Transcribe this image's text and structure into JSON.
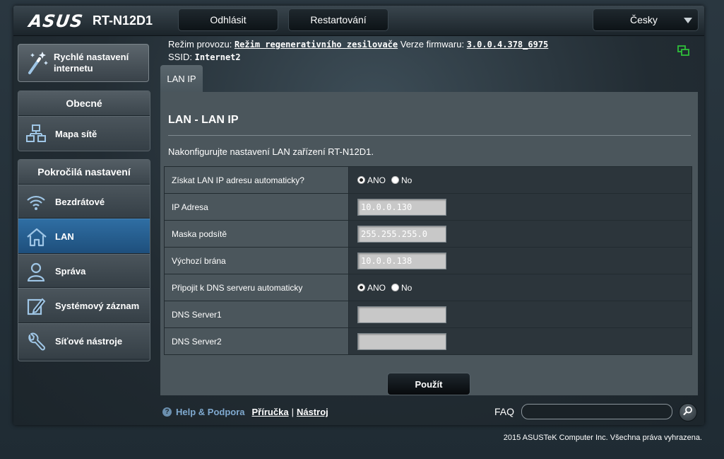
{
  "header": {
    "brand": "ASUS",
    "model": "RT-N12D1",
    "logout_label": "Odhlásit",
    "restart_label": "Restartování",
    "language": "Česky"
  },
  "info": {
    "mode_label": "Režim provozu:",
    "mode_value": "Režim regenerativního zesilovače",
    "firmware_label": "Verze firmwaru:",
    "firmware_value": "3.0.0.4.378_6975",
    "ssid_label": "SSID:",
    "ssid_value": "Internet2"
  },
  "sidebar": {
    "quick_setup": "Rychlé nastavení internetu",
    "general_header": "Obecné",
    "general_items": [
      {
        "label": "Mapa sítě",
        "icon": "network-map-icon"
      }
    ],
    "advanced_header": "Pokročilá nastavení",
    "advanced_items": [
      {
        "label": "Bezdrátové",
        "icon": "wifi-icon"
      },
      {
        "label": "LAN",
        "icon": "home-icon"
      },
      {
        "label": "Správa",
        "icon": "user-icon"
      },
      {
        "label": "Systémový záznam",
        "icon": "edit-log-icon"
      },
      {
        "label": "Síťové nástroje",
        "icon": "wrench-icon"
      }
    ],
    "active_item": "LAN"
  },
  "tab": {
    "label": "LAN IP"
  },
  "panel": {
    "title": "LAN - LAN IP",
    "description": "Nakonfigurujte nastavení LAN zařízení RT-N12D1.",
    "rows": {
      "auto_ip": {
        "label": "Získat LAN IP adresu automaticky?",
        "yes": "ANO",
        "no": "No",
        "selected": "yes"
      },
      "ip": {
        "label": "IP Adresa",
        "value": "10.0.0.130"
      },
      "mask": {
        "label": "Maska podsítě",
        "value": "255.255.255.0"
      },
      "gateway": {
        "label": "Výchozí brána",
        "value": "10.0.0.138"
      },
      "auto_dns": {
        "label": "Připojit k DNS serveru automaticky",
        "yes": "ANO",
        "no": "No",
        "selected": "yes"
      },
      "dns1": {
        "label": "DNS Server1",
        "value": ""
      },
      "dns2": {
        "label": "DNS Server2",
        "value": ""
      }
    },
    "apply_label": "Použít"
  },
  "footer": {
    "help_label": "Help & Podpora",
    "manual_link": "Příručka",
    "separator": "|",
    "tool_link": "Nástroj",
    "faq_label": "FAQ",
    "copyright": "2015 ASUSTeK Computer Inc. Všechna práva vyhrazena."
  },
  "colors": {
    "active_nav": "#2f6ea3",
    "help_text": "#7fa9cf",
    "status_icon": "#2fbf3a"
  }
}
